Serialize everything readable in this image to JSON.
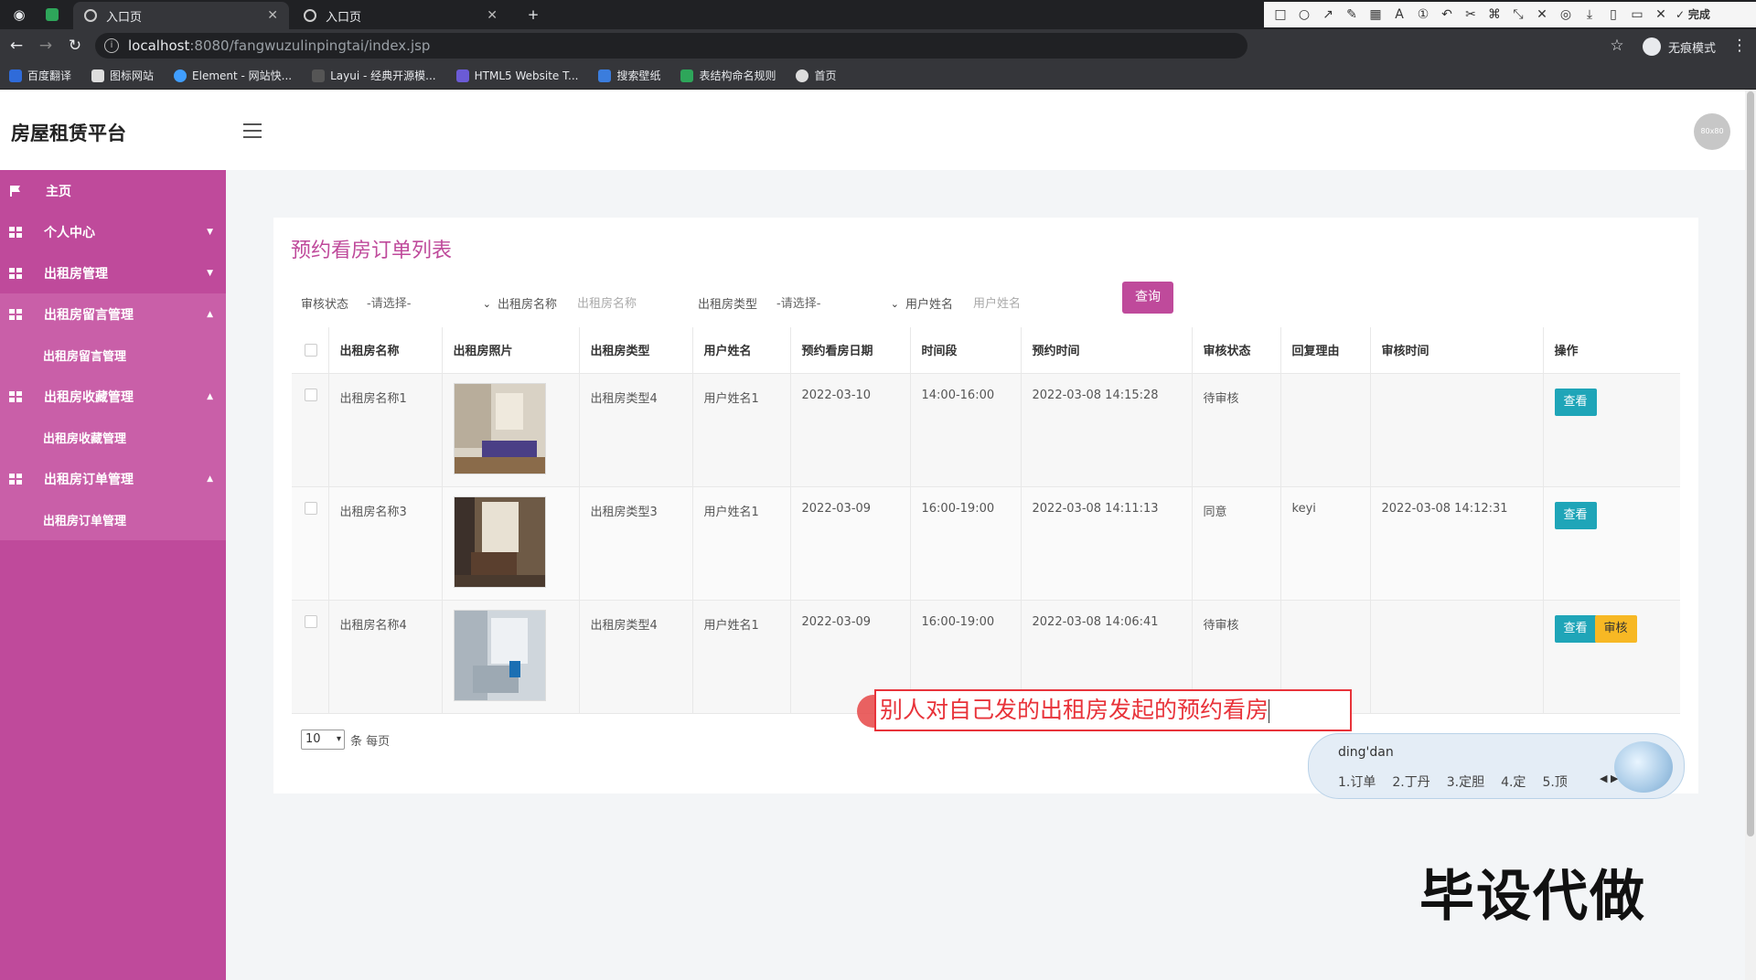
{
  "browser": {
    "tabs": [
      {
        "title": "入口页",
        "active": true
      },
      {
        "title": "入口页",
        "active": false
      }
    ],
    "new_tab": "+",
    "url_host": "localhost",
    "url_rest": ":8080/fangwuzulinpingtai/index.jsp",
    "incognito_label": "无痕模式",
    "bookmarks": [
      "百度翻译",
      "图标网站",
      "Element - 网站快...",
      "Layui - 经典开源模...",
      "HTML5 Website T...",
      "搜索壁纸",
      "表结构命名规则",
      "首页"
    ]
  },
  "annotation_toolbar": {
    "done_label": "完成",
    "font_size": "20",
    "font_icon": "A",
    "active_color": "#f23a3a",
    "palette": [
      "#000000",
      "#7f7f7f",
      "#7a1212",
      "#e03030",
      "#f39c12",
      "#2e9e44",
      "#3b5bd9",
      "#9b27b0",
      "#ffffff",
      "#c3c3c3",
      "#d35454",
      "#f4e20c",
      "#a3d534",
      "#4aa3e6",
      "#d142d1",
      "#27c1c1"
    ]
  },
  "header": {
    "app_title": "房屋租赁平台",
    "avatar_text": "80x80"
  },
  "sidebar": {
    "items": [
      {
        "label": "主页",
        "icon": "flag-icon"
      },
      {
        "label": "个人中心",
        "icon": "grid-icon",
        "caret": "▼"
      },
      {
        "label": "出租房管理",
        "icon": "grid-icon",
        "caret": "▼"
      },
      {
        "label": "出租房留言管理",
        "icon": "grid-icon",
        "caret": "▲",
        "open": true,
        "sub": "出租房留言管理"
      },
      {
        "label": "出租房收藏管理",
        "icon": "grid-icon",
        "caret": "▲",
        "open": true,
        "sub": "出租房收藏管理"
      },
      {
        "label": "出租房订单管理",
        "icon": "grid-icon",
        "caret": "▲",
        "open": true,
        "sub": "出租房订单管理"
      }
    ]
  },
  "page": {
    "title": "预约看房订单列表",
    "filters": {
      "status_label": "审核状态",
      "status_value": "-请选择-",
      "name_label": "出租房名称",
      "name_placeholder": "出租房名称",
      "type_label": "出租房类型",
      "type_value": "-请选择-",
      "user_label": "用户姓名",
      "user_placeholder": "用户姓名",
      "query_button": "查询"
    },
    "table": {
      "headers": [
        "出租房名称",
        "出租房照片",
        "出租房类型",
        "用户姓名",
        "预约看房日期",
        "时间段",
        "预约时间",
        "审核状态",
        "回复理由",
        "审核时间",
        "操作"
      ],
      "rows": [
        {
          "name": "出租房名称1",
          "type": "出租房类型4",
          "user": "用户姓名1",
          "date": "2022-03-10",
          "slot": "14:00-16:00",
          "booked": "2022-03-08 14:15:28",
          "status": "待审核",
          "reply": "",
          "audit_time": "",
          "view": "查看",
          "audit": ""
        },
        {
          "name": "出租房名称3",
          "type": "出租房类型3",
          "user": "用户姓名1",
          "date": "2022-03-09",
          "slot": "16:00-19:00",
          "booked": "2022-03-08 14:11:13",
          "status": "同意",
          "reply": "keyi",
          "audit_time": "2022-03-08 14:12:31",
          "view": "查看",
          "audit": ""
        },
        {
          "name": "出租房名称4",
          "type": "出租房类型4",
          "user": "用户姓名1",
          "date": "2022-03-09",
          "slot": "16:00-19:00",
          "booked": "2022-03-08 14:06:41",
          "status": "待审核",
          "reply": "",
          "audit_time": "",
          "view": "查看",
          "audit": "审核"
        }
      ]
    },
    "pager": {
      "page_size": "10",
      "suffix": "条 每页"
    }
  },
  "overlay": {
    "annotation_text": "别人对自己发的出租房发起的预约看房",
    "ime_pinyin": "ding'dan",
    "ime_candidates": [
      "1.订单",
      "2.丁丹",
      "3.定胆",
      "4.定",
      "5.顶"
    ],
    "watermark": "毕设代做"
  }
}
